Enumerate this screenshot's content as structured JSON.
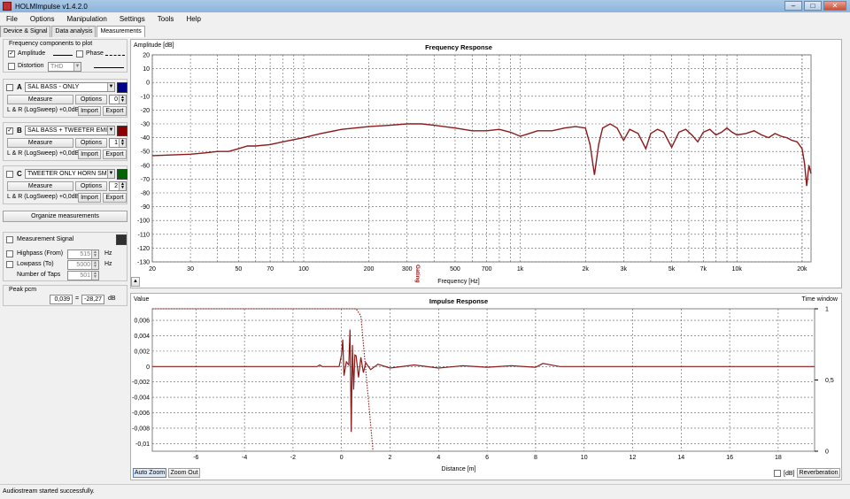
{
  "window": {
    "title": "HOLMImpulse  v1.4.2.0"
  },
  "menu": [
    "File",
    "Options",
    "Manipulation",
    "Settings",
    "Tools",
    "Help"
  ],
  "tabs": [
    "Device & Signal",
    "Data analysis",
    "Measurements"
  ],
  "freq_components": {
    "title": "Frequency components to plot",
    "amplitude": {
      "label": "Amplitude",
      "checked": true
    },
    "phase": {
      "label": "Phase",
      "checked": false
    },
    "distortion": {
      "label": "Distortion",
      "checked": false,
      "select": "THD"
    }
  },
  "measurements": [
    {
      "letter": "A",
      "checked": false,
      "name": "SAL BASS - ONLY",
      "color": "#00008b",
      "measure": "Measure",
      "options": "Options",
      "spin": "0",
      "info": "L & R (LogSweep) +0,0dB",
      "import": "Import",
      "export": "Export"
    },
    {
      "letter": "B",
      "checked": true,
      "name": "SAL BASS + TWEETER EMIN",
      "color": "#8b0000",
      "measure": "Measure",
      "options": "Options",
      "spin": "1",
      "info": "L & R (LogSweep) +0,0dB",
      "import": "Import",
      "export": "Export"
    },
    {
      "letter": "C",
      "checked": false,
      "name": "TWEETER ONLY HORN SM!",
      "color": "#006400",
      "measure": "Measure",
      "options": "Options",
      "spin": "2",
      "info": "L & R (LogSweep) +0,0dB",
      "import": "Import",
      "export": "Export"
    }
  ],
  "organize": "Organize measurements",
  "signal": {
    "label": "Measurement Signal",
    "color": "#303030",
    "highpass": {
      "label": "Highpass (From)",
      "value": "515",
      "unit": "Hz"
    },
    "lowpass": {
      "label": "Lowpass (To)",
      "value": "5000",
      "unit": "Hz"
    },
    "taps": {
      "label": "Number of Taps",
      "value": "501"
    }
  },
  "peak": {
    "label": "Peak pcm",
    "v1": "0,039",
    "sep": "=",
    "v2": "-28,27",
    "unit": "dB"
  },
  "freq_chart": {
    "ylabel": "Amplitude [dB]",
    "title": "Frequency Response",
    "xlabel": "Frequency [Hz]",
    "marker_label": "Gating",
    "yticks": [
      "20",
      "10",
      "0",
      "-10",
      "-20",
      "-30",
      "-40",
      "-50",
      "-60",
      "-70",
      "-80",
      "-90",
      "-100",
      "-110",
      "-120",
      "-130"
    ],
    "xticks": [
      "20",
      "30",
      "50",
      "70",
      "100",
      "200",
      "300",
      "500",
      "700",
      "1k",
      "2k",
      "3k",
      "5k",
      "7k",
      "10k",
      "20k"
    ]
  },
  "imp_chart": {
    "ylabel": "Value",
    "title": "Impulse Response",
    "xlabel": "Distance [m]",
    "window_label": "Time window",
    "yticks": [
      "0,006",
      "0,004",
      "0,002",
      "0",
      "-0,002",
      "-0,004",
      "-0,006",
      "-0,008",
      "-0,01"
    ],
    "xticks": [
      "-6",
      "-4",
      "-2",
      "0",
      "2",
      "4",
      "6",
      "8",
      "10",
      "12",
      "14",
      "16",
      "18"
    ],
    "rticks": [
      "1",
      "0,5",
      "0"
    ],
    "autozoom": "Auto Zoom",
    "zoomout": "Zoom Out",
    "db_label": "[dB]",
    "reverb": "Reverberation"
  },
  "chart_data": [
    {
      "type": "line",
      "title": "Frequency Response",
      "xlabel": "Frequency [Hz]",
      "ylabel": "Amplitude [dB]",
      "xscale": "log",
      "xlim": [
        20,
        22000
      ],
      "ylim": [
        -130,
        20
      ],
      "grid": true,
      "series": [
        {
          "color": "#8b1a1a",
          "x": [
            20,
            25,
            30,
            35,
            40,
            45,
            50,
            55,
            60,
            70,
            80,
            100,
            120,
            150,
            200,
            250,
            300,
            350,
            400,
            500,
            600,
            700,
            800,
            900,
            1000,
            1100,
            1200,
            1400,
            1600,
            1800,
            2000,
            2100,
            2200,
            2300,
            2400,
            2600,
            2800,
            3000,
            3200,
            3500,
            3800,
            4000,
            4300,
            4600,
            5000,
            5400,
            5800,
            6200,
            6600,
            7000,
            7500,
            8000,
            8500,
            9000,
            9500,
            10000,
            11000,
            12000,
            13000,
            14000,
            15000,
            16000,
            17000,
            18000,
            19000,
            20000,
            20500,
            21000,
            21500,
            22000
          ],
          "y": [
            -53,
            -52.5,
            -52,
            -51,
            -50,
            -50,
            -48,
            -46,
            -46,
            -45,
            -43,
            -40,
            -37,
            -34,
            -32,
            -31,
            -30,
            -30,
            -31,
            -33,
            -35,
            -35,
            -34,
            -36,
            -39,
            -37,
            -35,
            -35,
            -33,
            -32,
            -33,
            -45,
            -67,
            -45,
            -33,
            -30,
            -33,
            -42,
            -34,
            -37,
            -48,
            -37,
            -34,
            -36,
            -47,
            -36,
            -34,
            -38,
            -43,
            -36,
            -34,
            -38,
            -36,
            -33,
            -36,
            -38,
            -37,
            -35,
            -38,
            -40,
            -37,
            -39,
            -40,
            -42,
            -43,
            -48,
            -58,
            -75,
            -60,
            -66
          ]
        }
      ]
    },
    {
      "type": "line",
      "title": "Impulse Response",
      "xlabel": "Distance [m]",
      "ylabel": "Value",
      "xlim": [
        -7.8,
        19.5
      ],
      "ylim": [
        -0.011,
        0.0075
      ],
      "right_axis": {
        "label": "Time window",
        "ylim": [
          0,
          1
        ]
      },
      "grid": true,
      "series": [
        {
          "color": "#8b1a1a",
          "x": [
            -7.8,
            -1.0,
            -0.9,
            -0.8,
            -0.1,
            0.0,
            0.05,
            0.1,
            0.2,
            0.3,
            0.35,
            0.4,
            0.45,
            0.5,
            0.55,
            0.6,
            0.7,
            0.8,
            0.9,
            1.0,
            1.2,
            1.5,
            2.0,
            3.0,
            4.0,
            5.0,
            6.0,
            7.0,
            8.0,
            8.3,
            9.0,
            10.0,
            12.0,
            14.0,
            16.0,
            18.0,
            19.5
          ],
          "y": [
            0,
            0,
            0.0002,
            0,
            0,
            0.0015,
            0.0035,
            -0.0012,
            0.0006,
            0.0002,
            0.0048,
            -0.0085,
            0.0028,
            -0.003,
            0.0015,
            0.0014,
            -0.0014,
            0.0012,
            -0.0008,
            0.0005,
            -0.0004,
            0.0003,
            -0.0002,
            0.0002,
            -0.0002,
            0.0001,
            -0.0001,
            0.0001,
            -0.0001,
            0.0004,
            0,
            0,
            0,
            0,
            0,
            0,
            0
          ]
        },
        {
          "name": "Time window",
          "color": "#8b1a1a",
          "style": "dotted",
          "axis": "right",
          "x": [
            -7.8,
            0.6,
            0.8,
            1.3
          ],
          "y": [
            1,
            1,
            0.95,
            0
          ]
        }
      ]
    }
  ]
}
